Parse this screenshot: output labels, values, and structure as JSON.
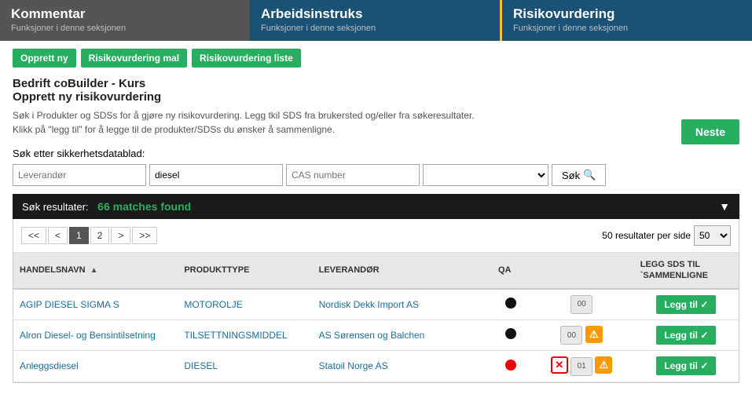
{
  "topNav": {
    "items": [
      {
        "id": "kommentar",
        "title": "Kommentar",
        "sub": "Funksjoner i denne seksjonen",
        "class": "kommentar"
      },
      {
        "id": "arbeidsinstruks",
        "title": "Arbeidsinstruks",
        "sub": "Funksjoner i denne seksjonen",
        "class": "arbeidsinstruks"
      },
      {
        "id": "risikovurdering",
        "title": "Risikovurdering",
        "sub": "Funksjoner i denne seksjonen",
        "class": "risikovurdering"
      }
    ]
  },
  "actionButtons": [
    {
      "id": "opprett-ny",
      "label": "Opprett ny"
    },
    {
      "id": "risikovurdering-mal",
      "label": "Risikovurdering mal"
    },
    {
      "id": "risikovurdering-liste",
      "label": "Risikovurdering liste"
    }
  ],
  "heading": {
    "company": "Bedrift coBuilder - Kurs",
    "title": "Opprett ny risikovurdering",
    "desc1": "Søk i Produkter og SDSs for å gjøre ny risikovurdering. Legg tkil SDS fra brukersted og/eller fra søkeresultater.",
    "desc2": "Klikk på \"legg til\" for å legge til de produkter/SDSs du ønsker å sammenligne."
  },
  "nesteButton": "Neste",
  "search": {
    "label": "Søk etter sikkerhetsdatablad:",
    "leverandorPlaceholder": "Leverandør",
    "dieselValue": "diesel",
    "casPlaceholder": "CAS number",
    "extraPlaceholder": "",
    "sokLabel": "Søk"
  },
  "results": {
    "label": "Søk resultater:",
    "matches": "66 matches found",
    "perPage": "50 resultater per side"
  },
  "pagination": {
    "first": "<<",
    "prev": "<",
    "pages": [
      "1",
      "2"
    ],
    "next": ">",
    "last": ">>"
  },
  "tableHeaders": {
    "handelsnavn": "HANDELSNAVN",
    "produkttype": "PRODUKTTYPE",
    "leverandor": "LEVERANDØR",
    "qa": "QA",
    "legg": "LEGG SDS TIL `SAMMENLIGNE"
  },
  "tableRows": [
    {
      "handelsnavn": "AGIP DIESEL SIGMA S",
      "produkttype": "MOTOROLJE",
      "leverandor": "Nordisk Dekk Import AS",
      "qa": "black",
      "icons": [
        "chat"
      ],
      "leggTil": "Legg til ✓"
    },
    {
      "handelsnavn": "Alron Diesel- og Bensintilsetning",
      "produkttype": "TILSETTNINGSMIDDEL",
      "leverandor": "AS Sørensen og Balchen",
      "qa": "black",
      "icons": [
        "chat",
        "warning"
      ],
      "leggTil": "Legg til ✓"
    },
    {
      "handelsnavn": "Anleggsdiesel",
      "produkttype": "DIESEL",
      "leverandor": "Statoil Norge AS",
      "qa": "red",
      "icons": [
        "x-mark",
        "chat01",
        "warning"
      ],
      "leggTil": "Legg til ✓"
    }
  ]
}
